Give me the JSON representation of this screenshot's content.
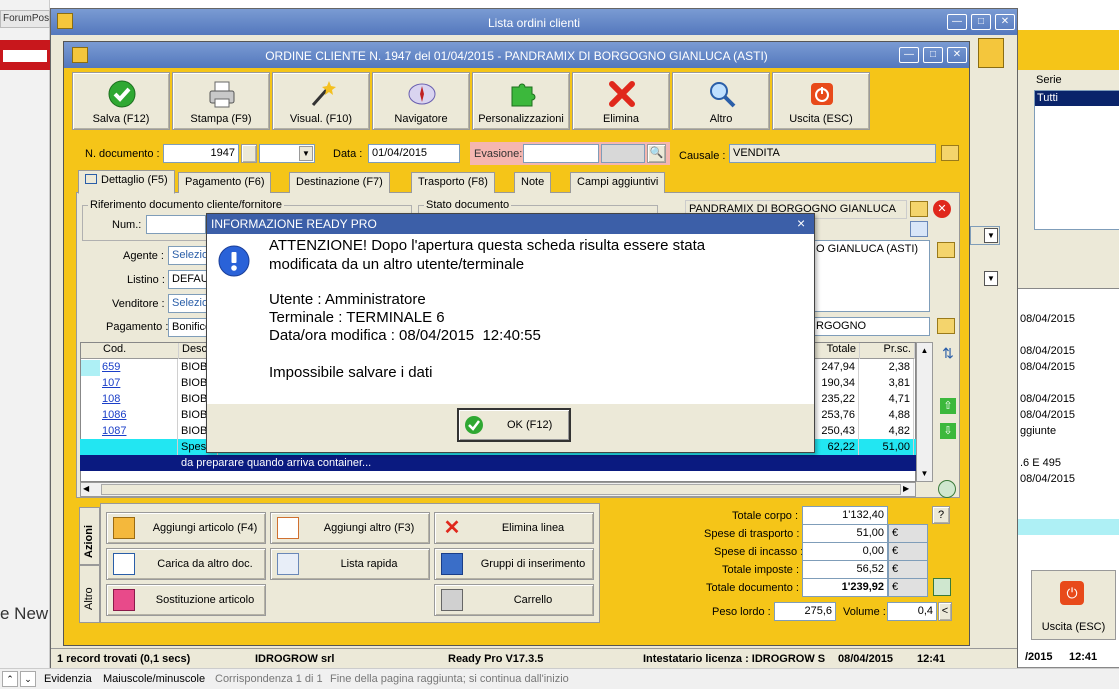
{
  "background": {
    "browser_tab_text": "ForumPos",
    "browser_side_text": "e New",
    "find_bar": {
      "evidenzia": "Evidenzia",
      "maiuscole": "Maiuscole/minuscole",
      "corrispondenza": "Corrispondenza 1 di 1",
      "fine": "Fine della pagina raggiunta; si continua dall'inizio"
    },
    "serie_label": "Serie",
    "serie_value": "Tutti",
    "right_dates": [
      "08/04/2015",
      "08/04/2015",
      "08/04/2015",
      "08/04/2015",
      "08/04/2015",
      "08/04/2015"
    ],
    "right_extra_1": "ggiunte",
    "right_extra_2": ".6 E 495",
    "uscita_label": "Uscita (ESC)",
    "right_status_date": "/2015",
    "right_status_time": "12:41"
  },
  "outer_window": {
    "title": "Lista ordini clienti",
    "status": {
      "records": "1 record trovati (0,1 secs)",
      "company": "IDROGROW srl",
      "version": "Ready Pro V17.3.5",
      "licensee": "Intestatario licenza : IDROGROW S",
      "date": "08/04/2015",
      "time": "12:41"
    }
  },
  "order_window": {
    "title": "ORDINE CLIENTE N. 1947 del 01/04/2015 - PANDRAMIX DI BORGOGNO GIANLUCA (ASTI)",
    "toolbar": [
      {
        "label": "Salva (F12)",
        "icon": "check-icon"
      },
      {
        "label": "Stampa (F9)",
        "icon": "printer-icon"
      },
      {
        "label": "Visual. (F10)",
        "icon": "magic-wand-icon"
      },
      {
        "label": "Navigatore",
        "icon": "compass-icon"
      },
      {
        "label": "Personalizzazioni",
        "icon": "puzzle-icon"
      },
      {
        "label": "Elimina",
        "icon": "delete-x-icon"
      },
      {
        "label": "Altro",
        "icon": "magnifier-icon"
      },
      {
        "label": "Uscita (ESC)",
        "icon": "exit-icon"
      }
    ],
    "n_documento_label": "N. documento :",
    "n_documento_value": "1947",
    "data_label": "Data :",
    "data_value": "01/04/2015",
    "evasione_label": "Evasione:",
    "causale_label": "Causale :",
    "causale_value": "VENDITA",
    "tabs": [
      "Dettaglio (F5)",
      "Pagamento (F6)",
      "Destinazione (F7)",
      "Trasporto (F8)",
      "Note",
      "Campi aggiuntivi"
    ],
    "rif_doc_label": "Riferimento documento cliente/fornitore",
    "num_label": "Num.:",
    "stato_doc_label": "Stato documento",
    "agente_label": "Agente :",
    "agente_value": "Selezio",
    "listino_label": "Listino :",
    "listino_value": "DEFAU",
    "venditore_label": "Venditore :",
    "venditore_value": "Selezio",
    "pagamento_label": "Pagamento :",
    "pagamento_value": "Bonifico",
    "customer_name": "PANDRAMIX DI BORGOGNO GIANLUCA",
    "customer_address_partial": "O GIANLUCA (ASTI)",
    "destination_partial": "RGOGNO",
    "grid": {
      "headers": {
        "cod": "Cod.",
        "desc": "Desc",
        "totale": "Totale",
        "prsc": "Pr.sc."
      },
      "rows": [
        {
          "cod": "659",
          "desc": "BIOB",
          "totale": "247,94",
          "prsc": "2,38"
        },
        {
          "cod": "107",
          "desc": "BIOB",
          "totale": "190,34",
          "prsc": "3,81"
        },
        {
          "cod": "108",
          "desc": "BIOB",
          "totale": "235,22",
          "prsc": "4,71"
        },
        {
          "cod": "1086",
          "desc": "BIOB",
          "totale": "253,76",
          "prsc": "4,88"
        },
        {
          "cod": "1087",
          "desc": "BIOB",
          "totale": "250,43",
          "prsc": "4,82"
        },
        {
          "cod": "",
          "desc": "Spes",
          "totale": "62,22",
          "prsc": "51,00"
        }
      ],
      "note_row": "da preparare quando arriva container..."
    },
    "side_tabs": [
      "Azioni",
      "Altro"
    ],
    "actions": [
      {
        "label": "Aggiungi articolo (F4)",
        "icon": "box-add-icon"
      },
      {
        "label": "Aggiungi altro (F3)",
        "icon": "grid-add-icon"
      },
      {
        "label": "Elimina linea",
        "icon": "delete-x-icon"
      },
      {
        "label": "Carica da altro doc.",
        "icon": "doc-check-icon"
      },
      {
        "label": "Lista rapida",
        "icon": "list-add-icon"
      },
      {
        "label": "Gruppi di inserimento",
        "icon": "group-add-icon"
      },
      {
        "label": "Sostituzione articolo",
        "icon": "swap-icon"
      },
      {
        "label": "",
        "icon": "blank"
      },
      {
        "label": "Carrello",
        "icon": "cart-icon"
      }
    ],
    "totals": [
      {
        "label": "Totale corpo :",
        "value": "1'132,40",
        "bold": false
      },
      {
        "label": "Spese di trasporto :",
        "value": "51,00",
        "bold": false
      },
      {
        "label": "Spese di incasso :",
        "value": "0,00",
        "bold": false
      },
      {
        "label": "Totale imposte :",
        "value": "56,52",
        "bold": false
      },
      {
        "label": "Totale documento :",
        "value": "1'239,92",
        "bold": true
      }
    ],
    "currency": "€",
    "question_btn": "?",
    "peso_lordo_label": "Peso lordo :",
    "peso_lordo_value": "275,6",
    "volume_label": "Volume :",
    "volume_value": "0,4",
    "volume_btn": "<"
  },
  "dialog": {
    "title": "INFORMAZIONE READY PRO",
    "close": "×",
    "message_line1": "ATTENZIONE! Dopo l'apertura questa scheda risulta essere stata",
    "message_line2": "modificata da un altro utente/terminale",
    "utente": "Utente : Amministratore",
    "terminale": "Terminale : TERMINALE 6",
    "data_ora": "Data/ora modifica : 08/04/2015  12:40:55",
    "error": "Impossibile salvare i dati",
    "ok_label": "OK (F12)"
  }
}
